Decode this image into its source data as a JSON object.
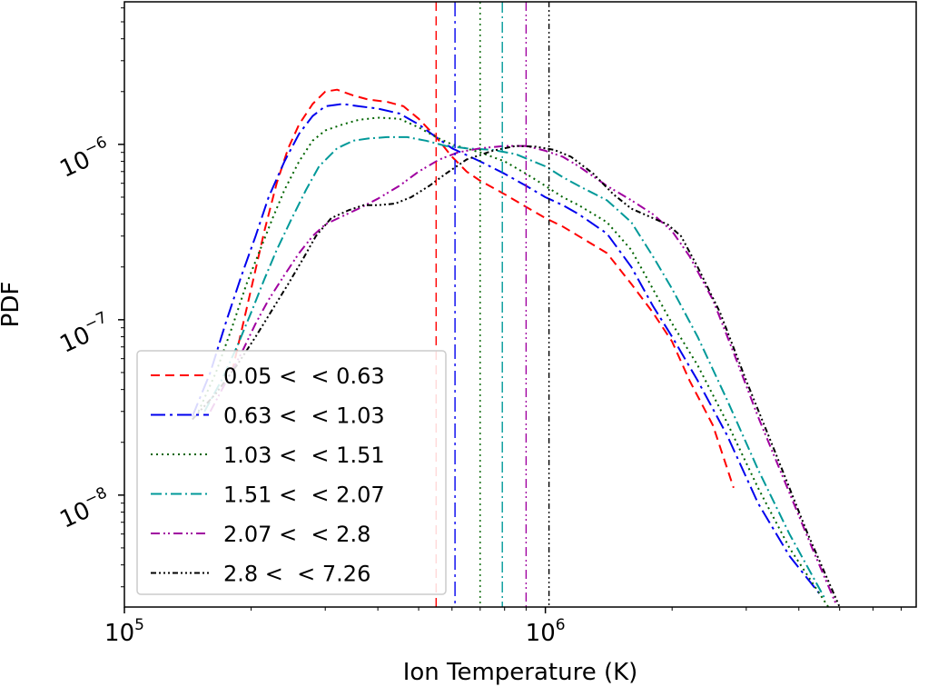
{
  "chart_data": {
    "type": "line",
    "xlabel": "Ion Temperature (K)",
    "ylabel": "PDF",
    "x_scale": "log",
    "y_scale": "log",
    "xlim": [
      100000,
      7600000
    ],
    "ylim": [
      2.3e-09,
      6.5e-06
    ],
    "x_ticks": [
      {
        "value": 100000,
        "base": "10",
        "exp": "5"
      },
      {
        "value": 1000000,
        "base": "10",
        "exp": "6"
      }
    ],
    "y_ticks": [
      {
        "value": 1e-08,
        "base": "10",
        "exp": "−8"
      },
      {
        "value": 1e-07,
        "base": "10",
        "exp": "−7"
      },
      {
        "value": 1e-06,
        "base": "10",
        "exp": "−6"
      }
    ],
    "grid": false,
    "legend_position": "lower-left",
    "series": [
      {
        "name": "0.05 < 𝒤 < 0.63",
        "color": "#ff0000",
        "dash": "10,6",
        "vline": 550000,
        "x": [
          180000,
          200000,
          215000,
          230000,
          245000,
          260000,
          280000,
          300000,
          320000,
          350000,
          380000,
          420000,
          460000,
          500000,
          550000,
          600000,
          650000,
          700000,
          800000,
          900000,
          1000000,
          1100000,
          1200000,
          1400000,
          1600000,
          1800000,
          2000000,
          2200000,
          2500000,
          2800000
        ],
        "y": [
          5e-08,
          1.5e-07,
          3.2e-07,
          6e-07,
          9.5e-07,
          1.3e-06,
          1.7e-06,
          2e-06,
          2.05e-06,
          1.9e-06,
          1.8e-06,
          1.75e-06,
          1.65e-06,
          1.4e-06,
          1.1e-06,
          8.5e-07,
          7e-07,
          6.2e-07,
          5.2e-07,
          4.4e-07,
          3.8e-07,
          3.4e-07,
          3e-07,
          2.4e-07,
          1.6e-07,
          1.1e-07,
          7.5e-08,
          4.5e-08,
          2.5e-08,
          1.1e-08
        ]
      },
      {
        "name": "0.63 < 𝒤 < 1.03",
        "color": "#0000ee",
        "dash": "16,5,3,5",
        "vline": 610000,
        "x": [
          145000,
          160000,
          175000,
          190000,
          205000,
          220000,
          240000,
          260000,
          280000,
          300000,
          330000,
          360000,
          400000,
          450000,
          500000,
          550000,
          600000,
          700000,
          800000,
          900000,
          1000000,
          1100000,
          1200000,
          1400000,
          1600000,
          1800000,
          2000000,
          2300000,
          2700000,
          3200000,
          3800000,
          4500000
        ],
        "y": [
          2.8e-08,
          5e-08,
          1e-07,
          1.8e-07,
          3e-07,
          5e-07,
          8e-07,
          1.15e-06,
          1.45e-06,
          1.65e-06,
          1.7e-06,
          1.65e-06,
          1.6e-06,
          1.5e-06,
          1.3e-06,
          1.1e-06,
          9.5e-07,
          8e-07,
          6.8e-07,
          5.8e-07,
          5e-07,
          4.5e-07,
          4e-07,
          3.1e-07,
          2e-07,
          1.2e-07,
          8e-08,
          4.5e-08,
          2.2e-08,
          9e-09,
          4.5e-09,
          2.7e-09
        ]
      },
      {
        "name": "1.03 < 𝒤 < 1.51",
        "color": "#006400",
        "dash": "2,4",
        "vline": 700000,
        "x": [
          150000,
          165000,
          180000,
          195000,
          210000,
          225000,
          240000,
          260000,
          280000,
          300000,
          330000,
          360000,
          400000,
          450000,
          500000,
          550000,
          600000,
          700000,
          800000,
          900000,
          1000000,
          1100000,
          1200000,
          1400000,
          1600000,
          1800000,
          2000000,
          2300000,
          2700000,
          3200000,
          3800000,
          4700000
        ],
        "y": [
          3e-08,
          5e-08,
          9e-08,
          1.6e-07,
          2.5e-07,
          3.8e-07,
          5.5e-07,
          8e-07,
          1.05e-06,
          1.2e-06,
          1.3e-06,
          1.38e-06,
          1.42e-06,
          1.4e-06,
          1.25e-06,
          1.1e-06,
          1e-06,
          9e-07,
          8e-07,
          6.8e-07,
          5.8e-07,
          5e-07,
          4.5e-07,
          3.6e-07,
          2.5e-07,
          1.5e-07,
          9.5e-08,
          5.5e-08,
          2.6e-08,
          1.1e-08,
          5e-09,
          2.3e-09
        ]
      },
      {
        "name": "1.51 < 𝒤 < 2.07",
        "color": "#009999",
        "dash": "12,4,2,4",
        "vline": 790000,
        "x": [
          155000,
          170000,
          185000,
          200000,
          215000,
          230000,
          250000,
          270000,
          290000,
          320000,
          350000,
          380000,
          420000,
          470000,
          520000,
          580000,
          650000,
          750000,
          850000,
          1000000,
          1100000,
          1200000,
          1400000,
          1600000,
          1800000,
          2000000,
          2300000,
          2700000,
          3200000,
          3800000,
          4600000
        ],
        "y": [
          3e-08,
          4.5e-08,
          7e-08,
          1.1e-07,
          1.7e-07,
          2.5e-07,
          3.8e-07,
          5.5e-07,
          7.5e-07,
          9.5e-07,
          1.05e-06,
          1.08e-06,
          1.1e-06,
          1.1e-06,
          1.05e-06,
          9.8e-07,
          9.5e-07,
          9.3e-07,
          8.8e-07,
          7.5e-07,
          6.5e-07,
          5.8e-07,
          4.8e-07,
          3.6e-07,
          2.3e-07,
          1.5e-07,
          8e-08,
          3.5e-08,
          1.4e-08,
          6e-09,
          2.6e-09
        ]
      },
      {
        "name": "2.07 < 𝒤 < 2.8",
        "color": "#a000a0",
        "dash": "10,4,2,3,2,4",
        "vline": 900000,
        "x": [
          160000,
          175000,
          190000,
          205000,
          220000,
          240000,
          260000,
          280000,
          300000,
          330000,
          360000,
          400000,
          450000,
          500000,
          560000,
          620000,
          700000,
          800000,
          900000,
          1000000,
          1100000,
          1200000,
          1400000,
          1600000,
          1800000,
          2000000,
          2200000,
          2500000,
          2800000,
          3200000,
          3700000,
          4300000,
          4900000
        ],
        "y": [
          3e-08,
          4.5e-08,
          6.5e-08,
          9.5e-08,
          1.3e-07,
          1.8e-07,
          2.4e-07,
          3e-07,
          3.5e-07,
          3.9e-07,
          4.3e-07,
          4.9e-07,
          5.8e-07,
          7e-07,
          8.2e-07,
          9e-07,
          9.5e-07,
          9.8e-07,
          9.8e-07,
          9.2e-07,
          8.5e-07,
          7.5e-07,
          5.8e-07,
          4.8e-07,
          4e-07,
          3.2e-07,
          2.3e-07,
          1.3e-07,
          6.5e-08,
          2.8e-08,
          1.2e-08,
          5e-09,
          2.4e-09
        ]
      },
      {
        "name": "2.8 < 𝒤 < 7.26",
        "color": "#000000",
        "dash": "6,3,2,3,2,3,2,3",
        "vline": 1020000,
        "x": [
          145000,
          165000,
          185000,
          205000,
          225000,
          245000,
          265000,
          285000,
          310000,
          340000,
          370000,
          400000,
          440000,
          480000,
          530000,
          580000,
          650000,
          750000,
          850000,
          950000,
          1050000,
          1150000,
          1300000,
          1450000,
          1600000,
          1800000,
          1950000,
          2100000,
          2300000,
          2600000,
          3000000,
          3500000,
          4200000,
          5000000
        ],
        "y": [
          2.7e-08,
          3.8e-08,
          5.5e-08,
          8e-08,
          1.15e-07,
          1.6e-07,
          2.2e-07,
          3e-07,
          3.8e-07,
          4.2e-07,
          4.5e-07,
          4.5e-07,
          4.6e-07,
          5e-07,
          5.8e-07,
          6.8e-07,
          8.2e-07,
          9.2e-07,
          9.8e-07,
          9.7e-07,
          9.3e-07,
          8.5e-07,
          6.8e-07,
          5.2e-07,
          4.3e-07,
          3.8e-07,
          3.5e-07,
          3e-07,
          2e-07,
          1.1e-07,
          4.5e-08,
          1.8e-08,
          6e-09,
          2.3e-09
        ]
      }
    ]
  }
}
